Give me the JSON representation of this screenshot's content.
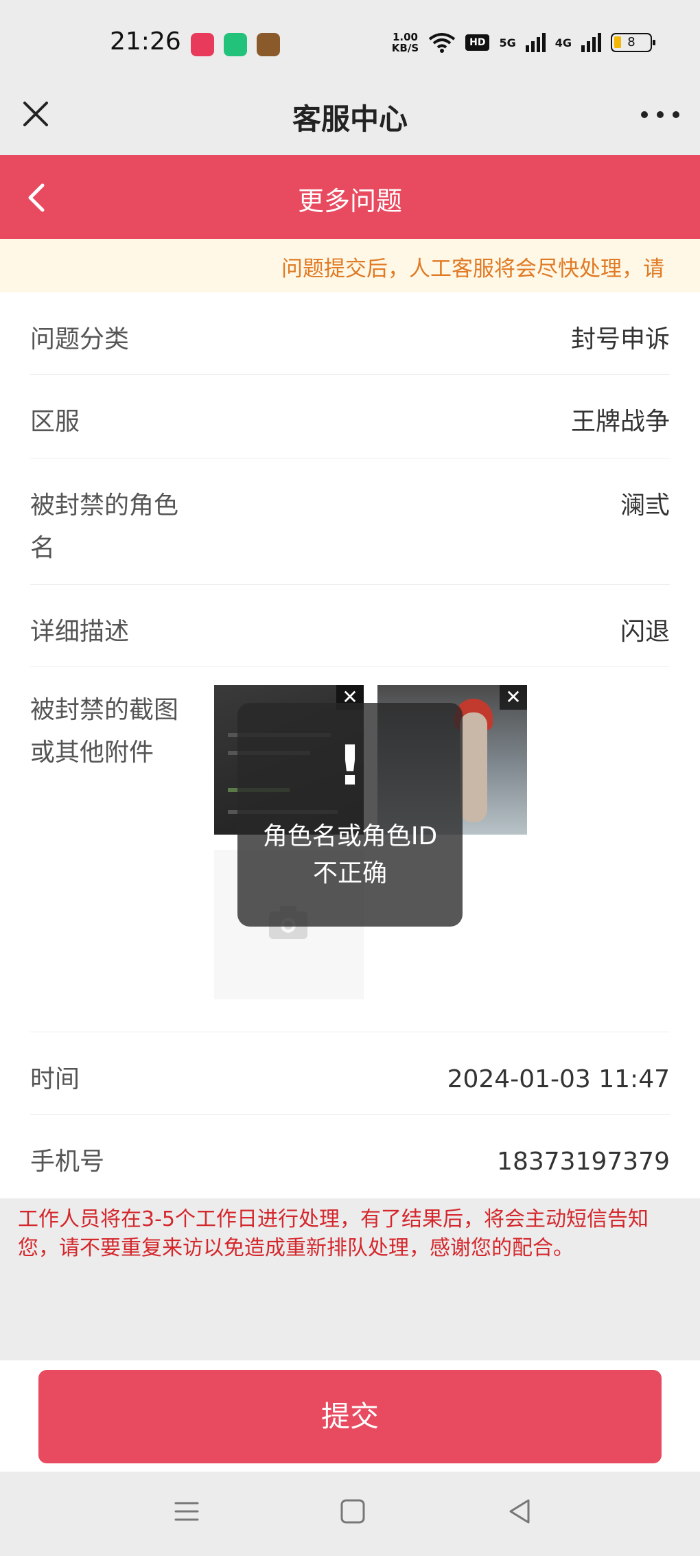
{
  "status_bar": {
    "time": "21:26",
    "speed_value": "1.00",
    "speed_unit": "KB/S",
    "hd": "HD",
    "net1": "5G",
    "net2": "4G",
    "battery": "8"
  },
  "title_bar": {
    "title": "客服中心"
  },
  "header": {
    "title": "更多问题"
  },
  "notice": {
    "text": "问题提交后，人工客服将会尽快处理，请"
  },
  "form": {
    "rows": [
      {
        "label": "问题分类",
        "value": "封号申诉"
      },
      {
        "label": "区服",
        "value": "王牌战争"
      },
      {
        "label": "被封禁的角色名",
        "value": "澜弎"
      },
      {
        "label": "详细描述",
        "value": "闪退"
      },
      {
        "label": "被封禁的截图或其他附件",
        "value": ""
      },
      {
        "label": "时间",
        "value": "2024-01-03 11:47"
      },
      {
        "label": "手机号",
        "value": "18373197379"
      }
    ]
  },
  "toast": {
    "icon": "!",
    "message": "角色名或角色ID不正确"
  },
  "footer_note": "工作人员将在3-5个工作日进行处理，有了结果后，将会主动短信告知您，请不要重复来访以免造成重新排队处理，感谢您的配合。",
  "submit_label": "提交",
  "colors": {
    "brand_red": "#e84a5f",
    "notice_orange": "#e07a25",
    "warning_red": "#d4272c"
  },
  "icons": [
    "close-icon",
    "more-icon",
    "back-icon",
    "camera-icon",
    "remove-image-icon",
    "menu-icon",
    "home-icon",
    "back-triangle-icon"
  ]
}
